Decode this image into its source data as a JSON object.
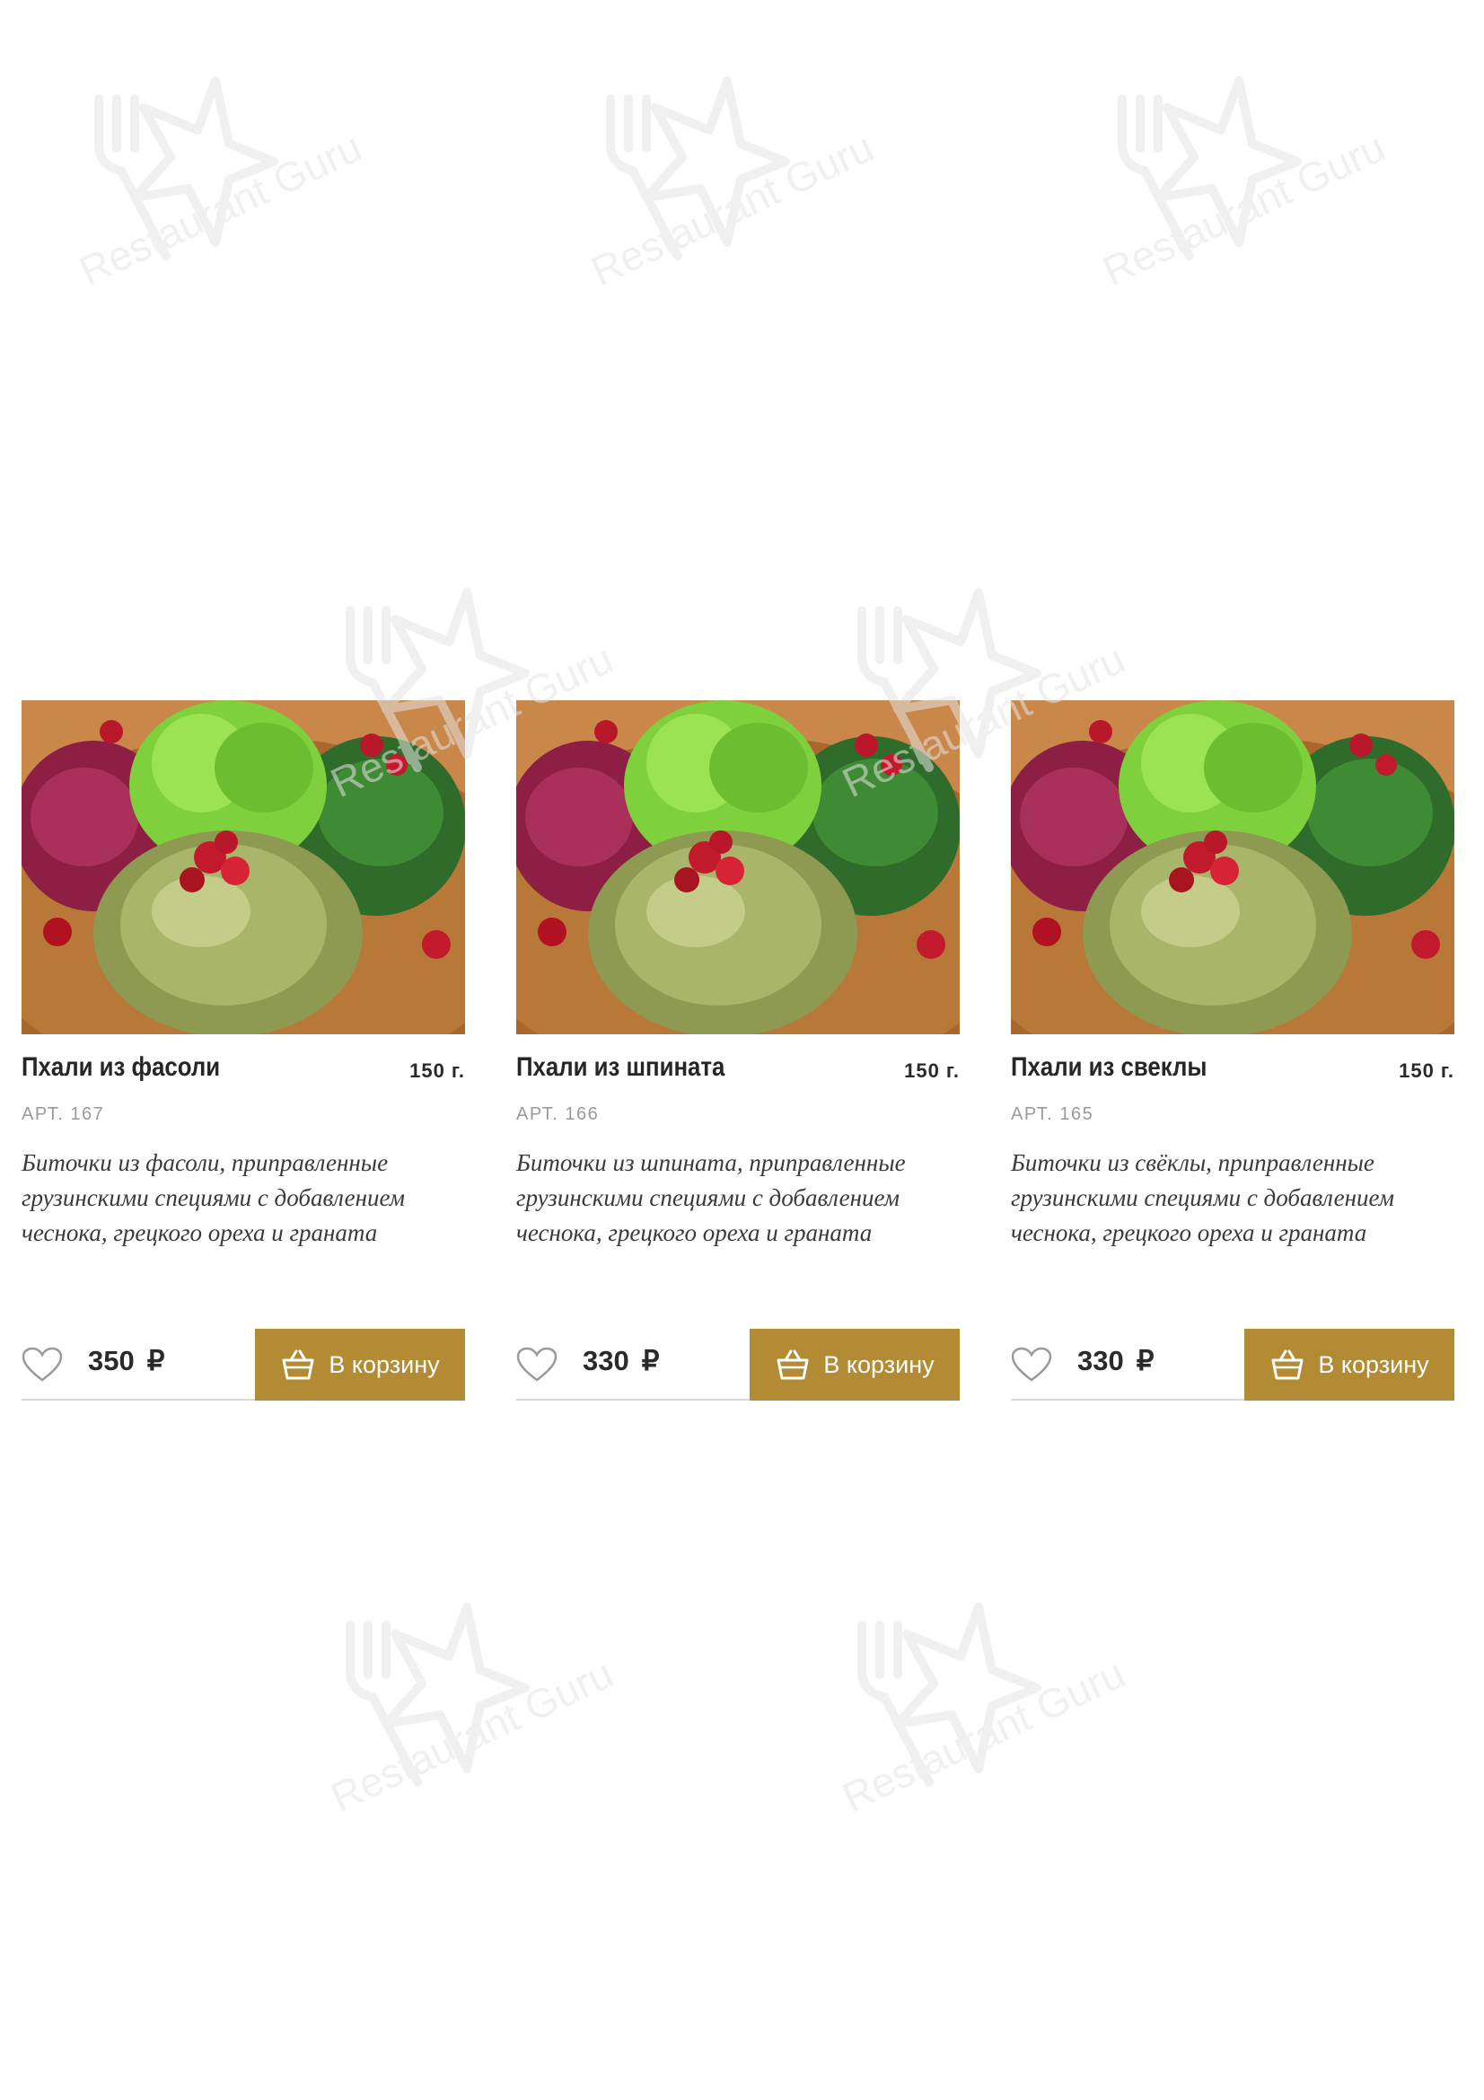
{
  "watermark": {
    "text": "Restaurant Guru",
    "icon": "fork-star-icon"
  },
  "colors": {
    "accent": "#b38b35",
    "title": "#262626",
    "sku": "#9a9a9a",
    "description": "#3a3a3a",
    "divider": "#d9d9d9"
  },
  "icons": {
    "favorite": "heart-outline-icon",
    "cart": "basket-icon"
  },
  "products": [
    {
      "title": "Пхали из фасоли",
      "weight": "150 г.",
      "sku": "АРТ. 167",
      "description": "Биточки из фасоли, приправленные грузинскими специями с добавлением чеснока, грецкого ореха и граната",
      "price": "350",
      "currency": "₽",
      "cart_label": "В корзину"
    },
    {
      "title": "Пхали из шпината",
      "weight": "150 г.",
      "sku": "АРТ. 166",
      "description": "Биточки из шпината, приправленные грузинскими специями с добавлением чеснока, грецкого ореха и граната",
      "price": "330",
      "currency": "₽",
      "cart_label": "В корзину"
    },
    {
      "title": "Пхали из свеклы",
      "weight": "150 г.",
      "sku": "АРТ. 165",
      "description": "Биточки из свёклы, приправленные грузинскими специями с добавлением чеснока, грецкого ореха и граната",
      "price": "330",
      "currency": "₽",
      "cart_label": "В корзину"
    }
  ]
}
